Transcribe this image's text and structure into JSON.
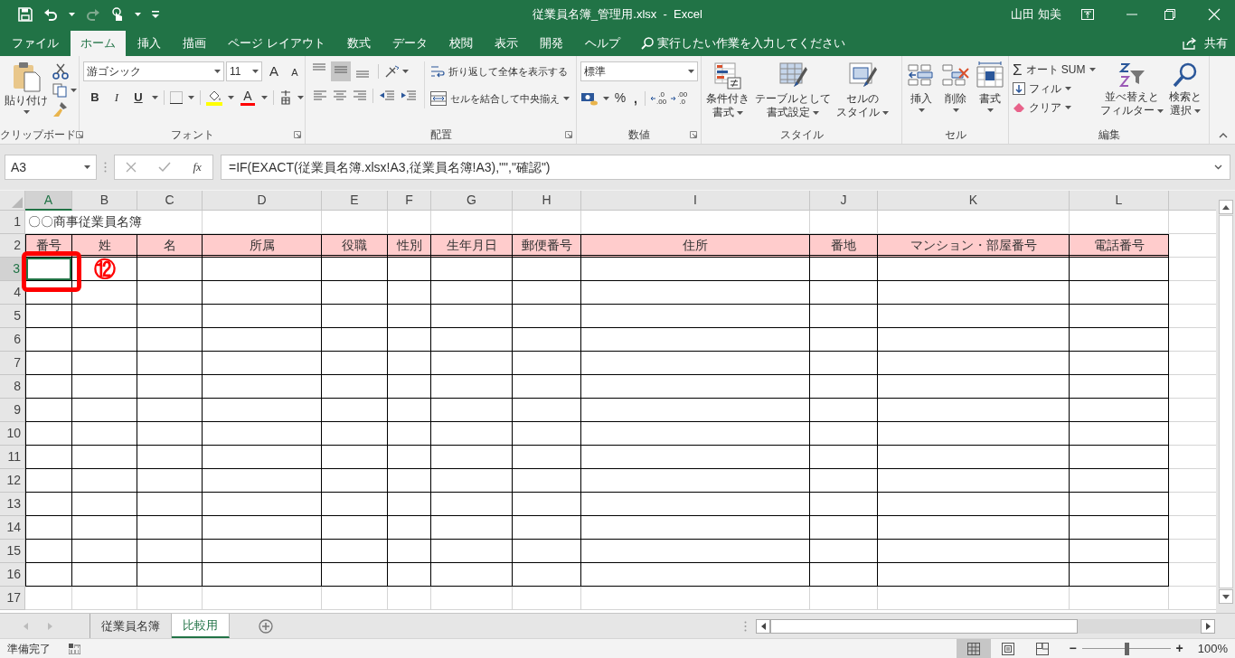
{
  "title_bar": {
    "title": "従業員名簿_管理用.xlsx  -  Excel",
    "user": "山田 知美"
  },
  "ribbon_tabs": [
    {
      "label": "ファイル",
      "selected": false
    },
    {
      "label": "ホーム",
      "selected": true
    },
    {
      "label": "挿入",
      "selected": false
    },
    {
      "label": "描画",
      "selected": false
    },
    {
      "label": "ページ レイアウト",
      "selected": false
    },
    {
      "label": "数式",
      "selected": false
    },
    {
      "label": "データ",
      "selected": false
    },
    {
      "label": "校閲",
      "selected": false
    },
    {
      "label": "表示",
      "selected": false
    },
    {
      "label": "開発",
      "selected": false
    },
    {
      "label": "ヘルプ",
      "selected": false
    }
  ],
  "tell_me": {
    "placeholder": "実行したい作業を入力してください"
  },
  "share": "共有",
  "ribbon": {
    "clipboard": {
      "label": "クリップボード",
      "paste": "貼り付け"
    },
    "font": {
      "label": "フォント",
      "font_name": "游ゴシック",
      "font_size": "11",
      "grow": "A",
      "shrink": "A",
      "bold": "B",
      "italic": "I",
      "underline": "U",
      "font_color": "A"
    },
    "alignment": {
      "label": "配置",
      "vertical_align": [
        {
          "selected": false
        },
        {
          "selected": true
        },
        {
          "selected": false
        }
      ],
      "wrap_text": "折り返して全体を表示する",
      "merge": "セルを結合して中央揃え"
    },
    "number": {
      "label": "数値",
      "format": "標準",
      "percent": "%",
      "comma": ",",
      "decimal_buttons": [
        {
          "top": ".0",
          "bottom": ".00"
        },
        {
          "top": ".00",
          "bottom": ".0"
        }
      ]
    },
    "styles": {
      "label": "スタイル",
      "buttons": [
        {
          "lines": [
            "条件付き",
            "書式"
          ]
        },
        {
          "lines": [
            "テーブルとして",
            "書式設定"
          ]
        },
        {
          "lines": [
            "セルの",
            "スタイル"
          ]
        }
      ]
    },
    "cells": {
      "label": "セル",
      "buttons": [
        "挿入",
        "削除",
        "書式"
      ]
    },
    "editing": {
      "label": "編集",
      "sigma": "Σ",
      "autosum": "オート SUM",
      "fill": "フィル",
      "clear": "クリア",
      "sort": [
        "並べ替えと",
        "フィルター"
      ],
      "find": [
        "検索と",
        "選択"
      ]
    }
  },
  "formula_bar": {
    "name_box": "A3",
    "fx": "fx",
    "formula": "=IF(EXACT(従業員名簿.xlsx!A3,従業員名簿!A3),\"\",\"確認\")"
  },
  "sheet": {
    "columns": [
      {
        "label": "A",
        "selected": true
      },
      {
        "label": "B",
        "selected": false
      },
      {
        "label": "C",
        "selected": false
      },
      {
        "label": "D",
        "selected": false
      },
      {
        "label": "E",
        "selected": false
      },
      {
        "label": "F",
        "selected": false
      },
      {
        "label": "G",
        "selected": false
      },
      {
        "label": "H",
        "selected": false
      },
      {
        "label": "I",
        "selected": false
      },
      {
        "label": "J",
        "selected": false
      },
      {
        "label": "K",
        "selected": false
      },
      {
        "label": "L",
        "selected": false
      }
    ],
    "rows": [
      {
        "label": "1",
        "selected": false
      },
      {
        "label": "2",
        "selected": false
      },
      {
        "label": "3",
        "selected": true
      },
      {
        "label": "4",
        "selected": false
      },
      {
        "label": "5",
        "selected": false
      },
      {
        "label": "6",
        "selected": false
      },
      {
        "label": "7",
        "selected": false
      },
      {
        "label": "8",
        "selected": false
      },
      {
        "label": "9",
        "selected": false
      },
      {
        "label": "10",
        "selected": false
      },
      {
        "label": "11",
        "selected": false
      },
      {
        "label": "12",
        "selected": false
      },
      {
        "label": "13",
        "selected": false
      },
      {
        "label": "14",
        "selected": false
      },
      {
        "label": "15",
        "selected": false
      },
      {
        "label": "16",
        "selected": false
      },
      {
        "label": "17",
        "selected": false
      }
    ],
    "title_cell": "〇〇商事従業員名簿",
    "header_cells": [
      "番号",
      "姓",
      "名",
      "所属",
      "役職",
      "性別",
      "生年月日",
      "郵便番号",
      "住所",
      "番地",
      "マンション・部屋番号",
      "電話番号"
    ],
    "annotation": "⑫"
  },
  "sheet_tabs": [
    {
      "label": "従業員名簿",
      "selected": false
    },
    {
      "label": "比較用",
      "selected": true
    }
  ],
  "status_bar": {
    "status": "準備完了",
    "views": [
      {
        "selected": true
      },
      {
        "selected": false
      },
      {
        "selected": false
      }
    ],
    "zoom": {
      "minus": "−",
      "plus": "+",
      "level": 0.5,
      "label": "100%"
    }
  }
}
